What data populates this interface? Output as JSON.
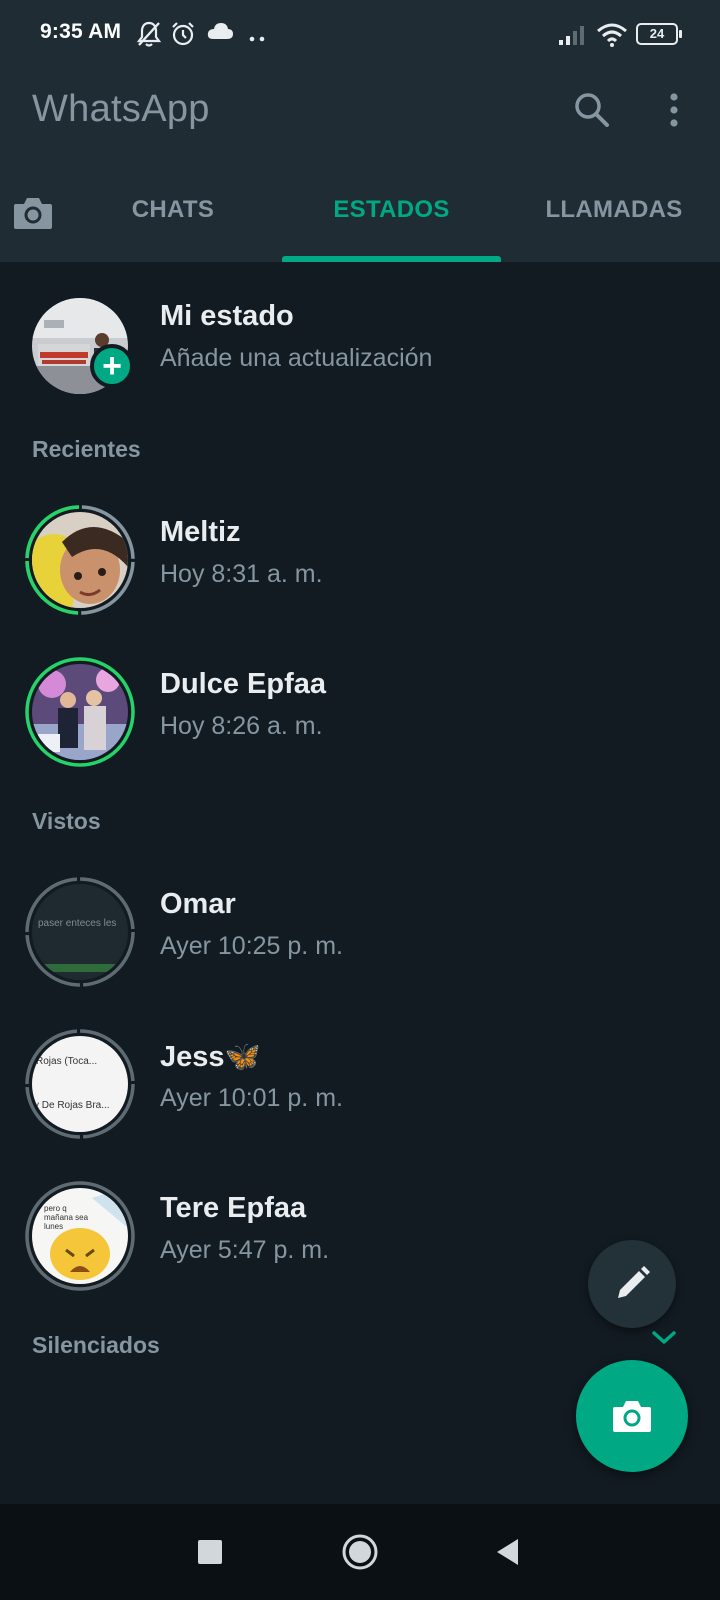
{
  "status_bar": {
    "time": "9:35 AM",
    "icons": [
      "bell-off-icon",
      "alarm-icon",
      "cloud-icon",
      "more-dots-icon",
      "signal-icon",
      "wifi-icon"
    ],
    "battery": "24"
  },
  "app_bar": {
    "title": "WhatsApp",
    "icons": [
      "search-icon",
      "overflow-menu-icon"
    ]
  },
  "tabs": {
    "camera_icon": "camera-icon",
    "items": [
      {
        "label": "CHATS"
      },
      {
        "label": "ESTADOS",
        "active": true
      },
      {
        "label": "LLAMADAS"
      }
    ]
  },
  "my_status": {
    "name": "Mi estado",
    "subtitle": "Añade una actualización"
  },
  "sections": {
    "recent": "Recientes",
    "viewed": "Vistos",
    "muted": "Silenciados"
  },
  "recent": [
    {
      "name": "Meltiz",
      "time": "Hoy 8:31 a. m."
    },
    {
      "name": "Dulce Epfaa",
      "time": "Hoy 8:26 a. m."
    }
  ],
  "viewed": [
    {
      "name": "Omar",
      "time": "Ayer 10:25 p. m.",
      "thumb_text": "paser enteces les"
    },
    {
      "name": "Jess🦋",
      "time": "Ayer 10:01 p. m.",
      "thumb_text_1": "Rojas (Toca...",
      "thumb_text_2": "y De Rojas Bra..."
    },
    {
      "name": "Tere Epfaa",
      "time": "Ayer 5:47 p. m.",
      "thumb_text": "pero q mañana sea lunes"
    }
  ],
  "fabs": {
    "edit_icon": "pencil-icon",
    "camera_icon": "camera-icon",
    "expand_icon": "chevron-down-icon"
  },
  "nav_bar": {
    "icons": [
      "recents-square-icon",
      "home-circle-icon",
      "back-triangle-icon"
    ]
  },
  "colors": {
    "accent": "#00a884",
    "background": "#121b22",
    "header": "#1f2c34",
    "secondary_text": "#8696a0",
    "unseen_ring": "#25d366",
    "seen_ring": "#8696a0"
  }
}
